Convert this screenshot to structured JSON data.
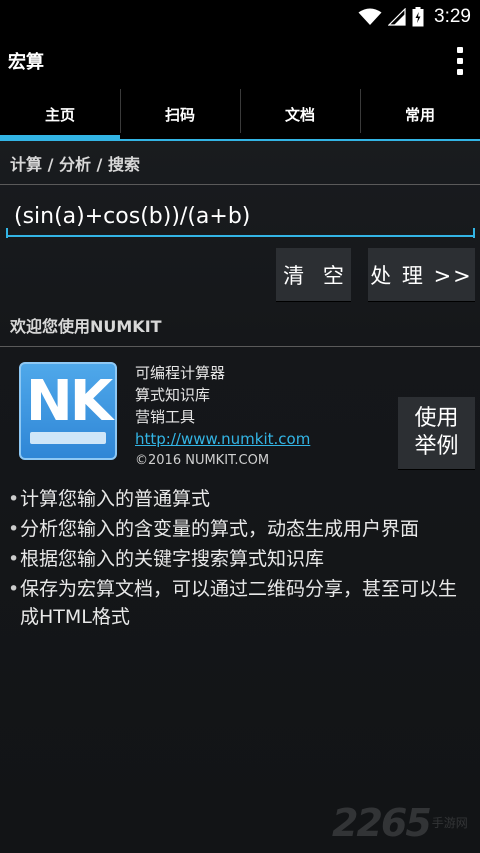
{
  "status_bar": {
    "time": "3:29",
    "icons": [
      "wifi-icon",
      "signal-icon",
      "battery-icon"
    ]
  },
  "action_bar": {
    "title": "宏算",
    "overflow_icon": "more-vert-icon"
  },
  "tabs": [
    {
      "label": "主页",
      "active": true
    },
    {
      "label": "扫码",
      "active": false
    },
    {
      "label": "文档",
      "active": false
    },
    {
      "label": "常用",
      "active": false
    }
  ],
  "calc_section": {
    "header": "计算 / 分析 / 搜索",
    "input_value": "(sin(a)+cos(b))/(a+b)",
    "clear_label": "清 空",
    "process_label": "处 理 >>"
  },
  "welcome_section": {
    "header": "欢迎您使用NUMKIT",
    "logo_text": "NK",
    "lines": [
      "可编程计算器",
      "算式知识库",
      "营销工具"
    ],
    "link": "http://www.numkit.com",
    "copyright": "©2016 NUMKIT.COM",
    "examples_line1": "使用",
    "examples_line2": "举例",
    "bullets": [
      "计算您输入的普通算式",
      "分析您输入的含变量的算式，动态生成用户界面",
      "根据您输入的关键字搜索算式知识库",
      "保存为宏算文档，可以通过二维码分享，甚至可以生成HTML格式"
    ]
  },
  "watermark": {
    "number": "2265",
    "text": "手游网"
  },
  "colors": {
    "accent": "#33b5e5",
    "background": "#17191c",
    "button": "#2c2f33"
  }
}
